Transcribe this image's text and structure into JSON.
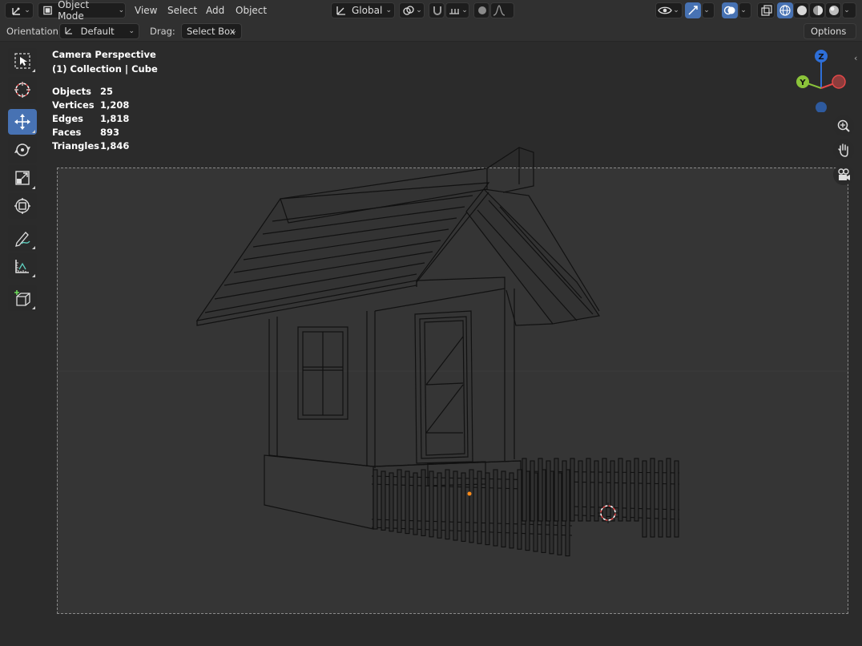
{
  "header": {
    "mode_label": "Object Mode",
    "menus": [
      "View",
      "Select",
      "Add",
      "Object"
    ],
    "transform_orientation": "Global"
  },
  "tool_settings": {
    "orientation_label": "Orientation:",
    "orientation_value": "Default",
    "drag_label": "Drag:",
    "drag_value": "Select Box",
    "options_label": "Options"
  },
  "viewport": {
    "view_name": "Camera Perspective",
    "collection_info": "(1) Collection | Cube",
    "stats": [
      {
        "label": "Objects",
        "value": "25"
      },
      {
        "label": "Vertices",
        "value": "1,208"
      },
      {
        "label": "Edges",
        "value": "1,818"
      },
      {
        "label": "Faces",
        "value": "893"
      },
      {
        "label": "Triangles",
        "value": "1,846"
      }
    ],
    "gizmo": {
      "z": "Z",
      "y": "Y"
    }
  },
  "tools": [
    {
      "name": "select-box-tool",
      "icon": "select-box-icon",
      "active": false
    },
    {
      "name": "cursor-tool",
      "icon": "cursor-icon",
      "active": false
    },
    {
      "name": "move-tool",
      "icon": "move-icon",
      "active": true
    },
    {
      "name": "rotate-tool",
      "icon": "rotate-icon",
      "active": false
    },
    {
      "name": "scale-tool",
      "icon": "scale-icon",
      "active": false
    },
    {
      "name": "transform-tool",
      "icon": "transform-icon",
      "active": false
    },
    {
      "name": "annotate-tool",
      "icon": "annotate-icon",
      "active": false
    },
    {
      "name": "measure-tool",
      "icon": "measure-icon",
      "active": false
    },
    {
      "name": "add-cube-tool",
      "icon": "add-cube-icon",
      "active": false
    }
  ],
  "colors": {
    "accent": "#4772b3",
    "axis_z": "#2e6fd8",
    "axis_y": "#8bc43a",
    "axis_x": "#e34848",
    "origin": "#ff8c1a"
  }
}
